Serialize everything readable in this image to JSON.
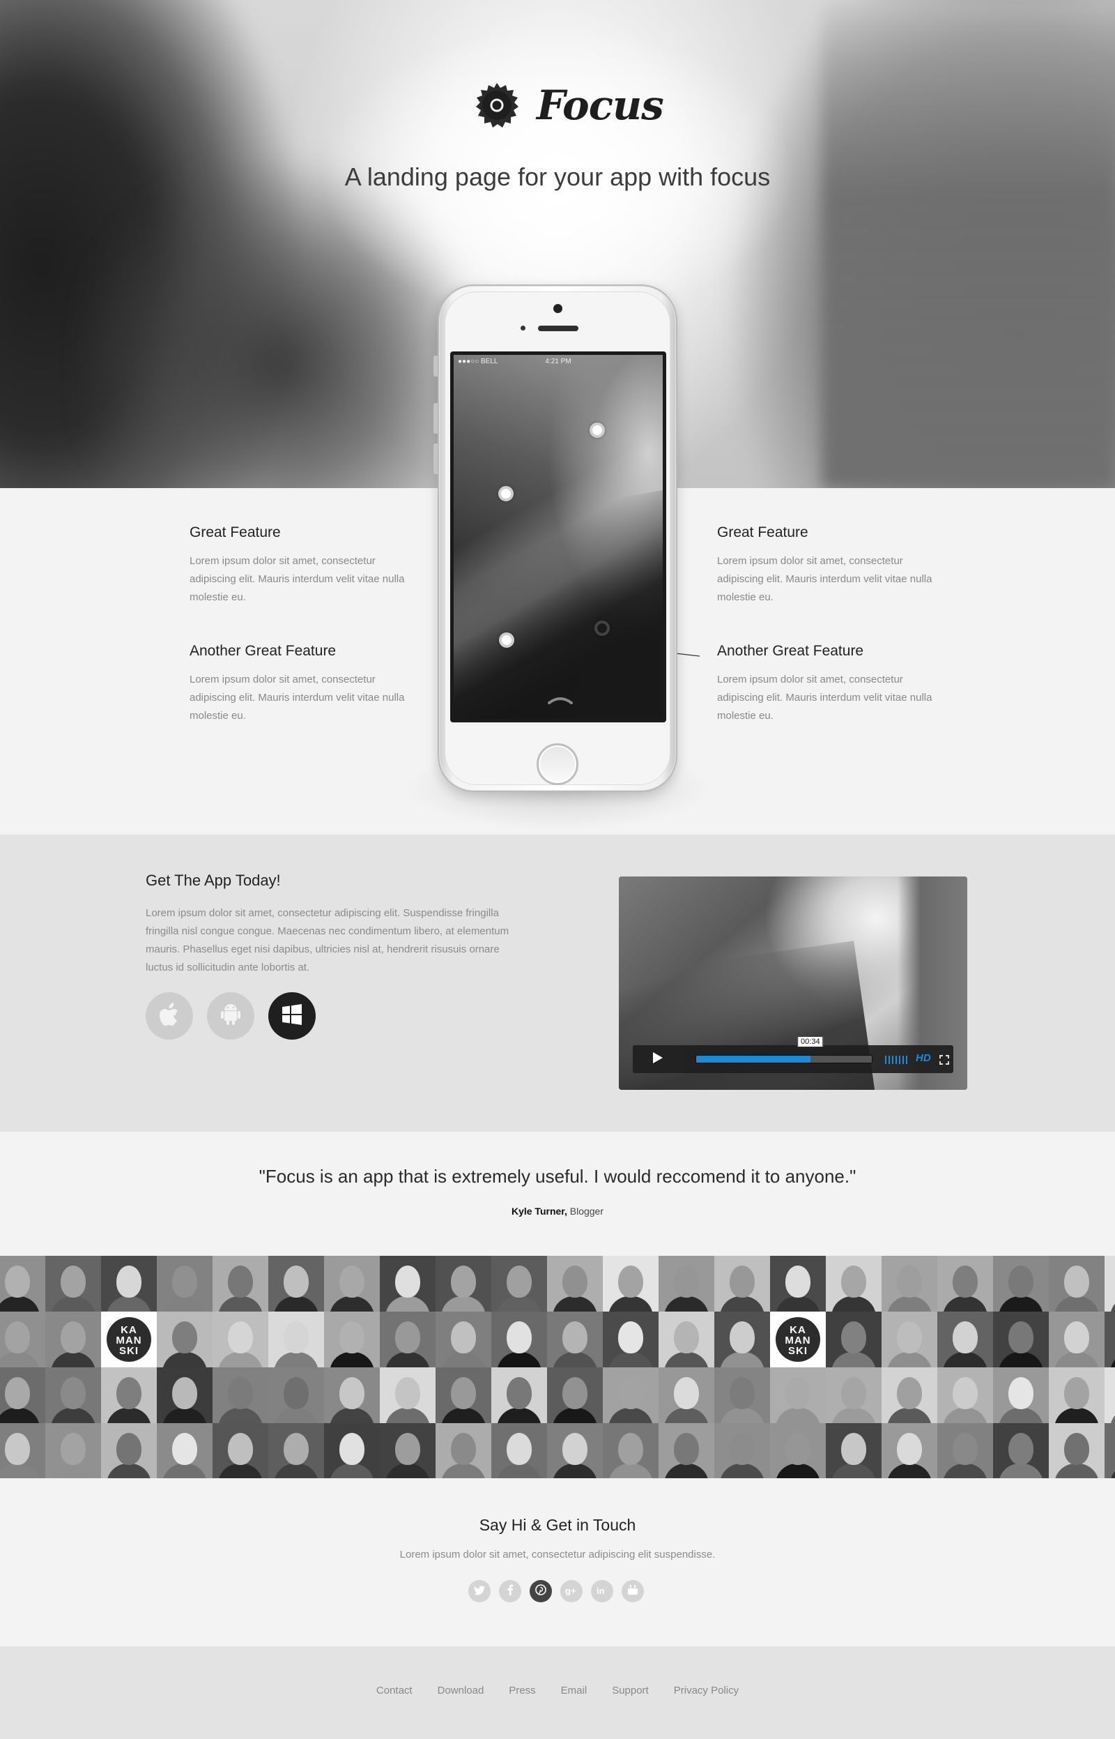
{
  "brand": {
    "name": "Focus",
    "logo_icon": "focus-badge-icon"
  },
  "hero": {
    "tagline": "A landing page for your app with focus"
  },
  "phone": {
    "carrier": "●●●○○ BELL",
    "time": "4:21 PM"
  },
  "features": {
    "left": [
      {
        "title": "Great Feature",
        "text": "Lorem ipsum dolor sit amet, consectetur adipiscing elit. Mauris interdum velit vitae nulla molestie eu."
      },
      {
        "title": "Another Great Feature",
        "text": "Lorem ipsum dolor sit amet, consectetur adipiscing elit. Mauris interdum velit vitae nulla molestie eu."
      }
    ],
    "right": [
      {
        "title": "Great Feature",
        "text": "Lorem ipsum dolor sit amet, consectetur adipiscing elit. Mauris interdum velit vitae nulla molestie eu."
      },
      {
        "title": "Another Great Feature",
        "text": "Lorem ipsum dolor sit amet, consectetur adipiscing elit. Mauris interdum velit vitae nulla molestie eu."
      }
    ]
  },
  "get_app": {
    "title": "Get The App Today!",
    "text": "Lorem ipsum dolor sit amet, consectetur adipiscing elit. Suspendisse fringilla fringilla nisl congue congue. Maecenas nec condimentum libero, at elementum mauris. Phasellus eget nisi dapibus, ultricies nisl at, hendrerit risusuis ornare luctus id sollicitudin ante lobortis at.",
    "stores": [
      {
        "icon": "apple-icon",
        "active": false
      },
      {
        "icon": "android-icon",
        "active": false
      },
      {
        "icon": "windows-icon",
        "active": true
      }
    ]
  },
  "video": {
    "time_label": "00:34",
    "progress": 0.65,
    "hd_label": "HD",
    "accent": "#1e8ad6"
  },
  "testimonial": {
    "quote": "\"Focus is an app that is extremely useful. I would reccomend it to anyone.\"",
    "author": "Kyle Turner,",
    "role": "Blogger"
  },
  "faces": {
    "kaman_lines": [
      "KA",
      "MAN",
      "SKI"
    ]
  },
  "contact": {
    "title": "Say Hi & Get in Touch",
    "subtitle": "Lorem ipsum dolor sit amet, consectetur adipiscing elit suspendisse.",
    "social": [
      {
        "icon": "twitter-icon",
        "active": false
      },
      {
        "icon": "facebook-icon",
        "active": false
      },
      {
        "icon": "pinterest-icon",
        "active": true
      },
      {
        "icon": "google-plus-icon",
        "active": false
      },
      {
        "icon": "linkedin-icon",
        "active": false
      },
      {
        "icon": "youtube-icon",
        "active": false
      }
    ]
  },
  "footer": {
    "links": [
      "Contact",
      "Download",
      "Press",
      "Email",
      "Support",
      "Privacy Policy"
    ]
  }
}
